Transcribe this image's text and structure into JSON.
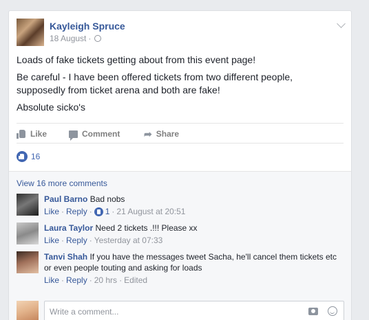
{
  "post": {
    "author": "Kayleigh Spruce",
    "date": "18 August",
    "separator": "·",
    "paragraphs": [
      "Loads of fake tickets getting about from this event page!",
      "Be careful - I have been offered tickets from two different people, supposedly from ticket arena and both are fake!",
      "Absolute sicko's"
    ]
  },
  "actions": {
    "like": "Like",
    "comment": "Comment",
    "share": "Share"
  },
  "reactions": {
    "count": "16"
  },
  "comments": {
    "view_more": "View 16 more comments",
    "items": [
      {
        "name": "Paul Barno",
        "text": "Bad nobs",
        "like": "Like",
        "reply": "Reply",
        "likes": "1",
        "time": "21 August at 20:51"
      },
      {
        "name": "Laura Taylor",
        "text": "Need 2 tickets .!!! Please xx",
        "like": "Like",
        "reply": "Reply",
        "time": "Yesterday at 07:33"
      },
      {
        "name": "Tanvi Shah",
        "text": "If you have the messages tweet Sacha, he'll cancel them tickets etc or even people touting and asking for loads",
        "like": "Like",
        "reply": "Reply",
        "time": "20 hrs",
        "edited": "Edited"
      }
    ],
    "write_placeholder": "Write a comment..."
  },
  "colors": {
    "link": "#365899",
    "accent": "#4267b2",
    "muted": "#90949c"
  },
  "icons": [
    "globe-icon",
    "chevron-down-icon",
    "like-icon",
    "comment-icon",
    "share-icon",
    "camera-icon",
    "smiley-icon"
  ]
}
